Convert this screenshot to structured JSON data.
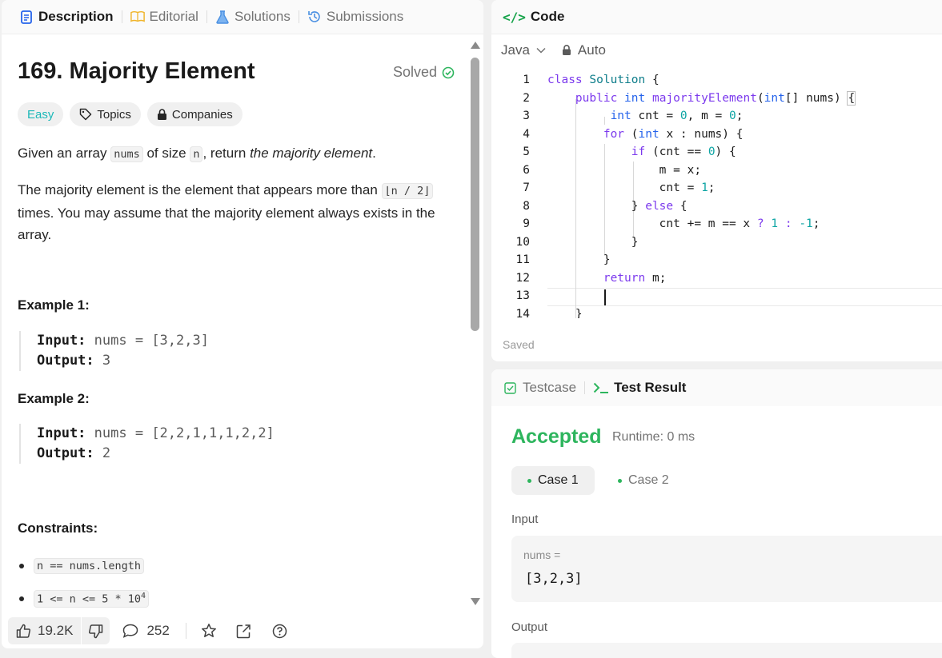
{
  "left_tabs": [
    {
      "label": "Description"
    },
    {
      "label": "Editorial"
    },
    {
      "label": "Solutions"
    },
    {
      "label": "Submissions"
    }
  ],
  "problem": {
    "title": "169. Majority Element",
    "status": "Solved",
    "difficulty": "Easy",
    "topics_label": "Topics",
    "companies_label": "Companies",
    "desc1_a": "Given an array ",
    "desc1_code1": "nums",
    "desc1_b": " of size ",
    "desc1_code2": "n",
    "desc1_c": ", return ",
    "desc1_em": "the majority element",
    "desc1_d": ".",
    "desc2_a": "The majority element is the element that appears more than ",
    "desc2_code": "⌊n / 2⌋",
    "desc2_b": " times. You may assume that the majority element always exists in the array.",
    "example1_title": "Example 1:",
    "example1_input_label": "Input:",
    "example1_input": "nums = [3,2,3]",
    "example1_output_label": "Output:",
    "example1_output": "3",
    "example2_title": "Example 2:",
    "example2_input_label": "Input:",
    "example2_input": "nums = [2,2,1,1,1,2,2]",
    "example2_output_label": "Output:",
    "example2_output": "2",
    "constraints_title": "Constraints:",
    "constraint1": "n == nums.length",
    "constraint2_a": "1 <= n <= 5 * 10",
    "constraint2_sup": "4"
  },
  "footer": {
    "likes": "19.2K",
    "comments": "252"
  },
  "code_panel": {
    "title": "Code",
    "language": "Java",
    "mode": "Auto",
    "saved": "Saved",
    "line_numbers": [
      "1",
      "2",
      "3",
      "4",
      "5",
      "6",
      "7",
      "8",
      "9",
      "10",
      "11",
      "12",
      "13",
      "14"
    ]
  },
  "result_panel": {
    "testcase_tab": "Testcase",
    "result_tab": "Test Result",
    "status": "Accepted",
    "runtime": "Runtime: 0 ms",
    "case1": "Case 1",
    "case2": "Case 2",
    "input_label": "Input",
    "input_key": "nums =",
    "input_value": "[3,2,3]",
    "output_label": "Output"
  }
}
